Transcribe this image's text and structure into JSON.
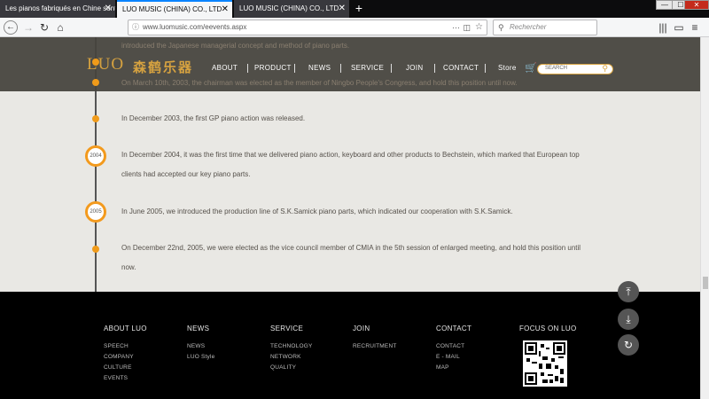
{
  "browser": {
    "tabs": [
      {
        "title": "Les pianos fabriqués en Chine sont"
      },
      {
        "title": "LUO MUSIC (CHINA) CO., LTD"
      },
      {
        "title": "LUO MUSIC (CHINA) CO., LTD"
      }
    ],
    "new_tab": "+",
    "window": {
      "minimize": "—",
      "maximize": "☐",
      "close": "✕"
    },
    "url": "www.luomusic.com/eevents.aspx",
    "search_placeholder": "Rechercher"
  },
  "site": {
    "logo_latin": "LUO",
    "logo_cn": "森鹤乐器",
    "menu": [
      {
        "label": "ABOUT"
      },
      {
        "label": "PRODUCT"
      },
      {
        "label": "NEWS"
      },
      {
        "label": "SERVICE"
      },
      {
        "label": "JOIN"
      },
      {
        "label": "CONTACT"
      },
      {
        "label": "Store"
      }
    ],
    "search_placeholder": "SEARCH",
    "behind_header_text": [
      "introduced the Japanese managerial concept and method of piano parts.",
      "On March 10th, 2003, the chairman was elected as the member of Ningbo People's Congress, and hold this position until now."
    ]
  },
  "timeline": {
    "events": [
      {
        "year": "",
        "text": "In December 2003, the first GP piano action was released."
      },
      {
        "year": "2004",
        "text": "In December 2004, it was the first time that we delivered piano action, keyboard and other products to Bechstein, which marked that European top clients had accepted our key piano parts."
      },
      {
        "year": "2005",
        "text": "In June 2005, we introduced the production line of S.K.Samick piano parts, which indicated our cooperation with S.K.Samick."
      },
      {
        "year": "",
        "text": "On December 22nd, 2005, we were elected as the vice council member of CMIA in the 5th session of enlarged meeting, and hold this position until now."
      }
    ]
  },
  "footer": {
    "columns": [
      {
        "heading": "ABOUT LUO",
        "links": [
          "SPEECH",
          "COMPANY",
          "CULTURE",
          "EVENTS"
        ]
      },
      {
        "heading": "NEWS",
        "links": [
          "NEWS",
          "LUO Style"
        ]
      },
      {
        "heading": "SERVICE",
        "links": [
          "TECHNOLOGY",
          "NETWORK",
          "QUALITY"
        ]
      },
      {
        "heading": "JOIN",
        "links": [
          "RECRUITMENT"
        ]
      },
      {
        "heading": "CONTACT",
        "links": [
          "CONTACT",
          "E - MAIL",
          "MAP"
        ]
      },
      {
        "heading": "FOCUS ON LUO",
        "links": []
      }
    ]
  },
  "colors": {
    "accent": "#f39a1d",
    "logo_gold": "#d6a240",
    "header_bg": "#46443e",
    "page_bg": "#e9e8e4",
    "footer_bg": "#000000"
  }
}
